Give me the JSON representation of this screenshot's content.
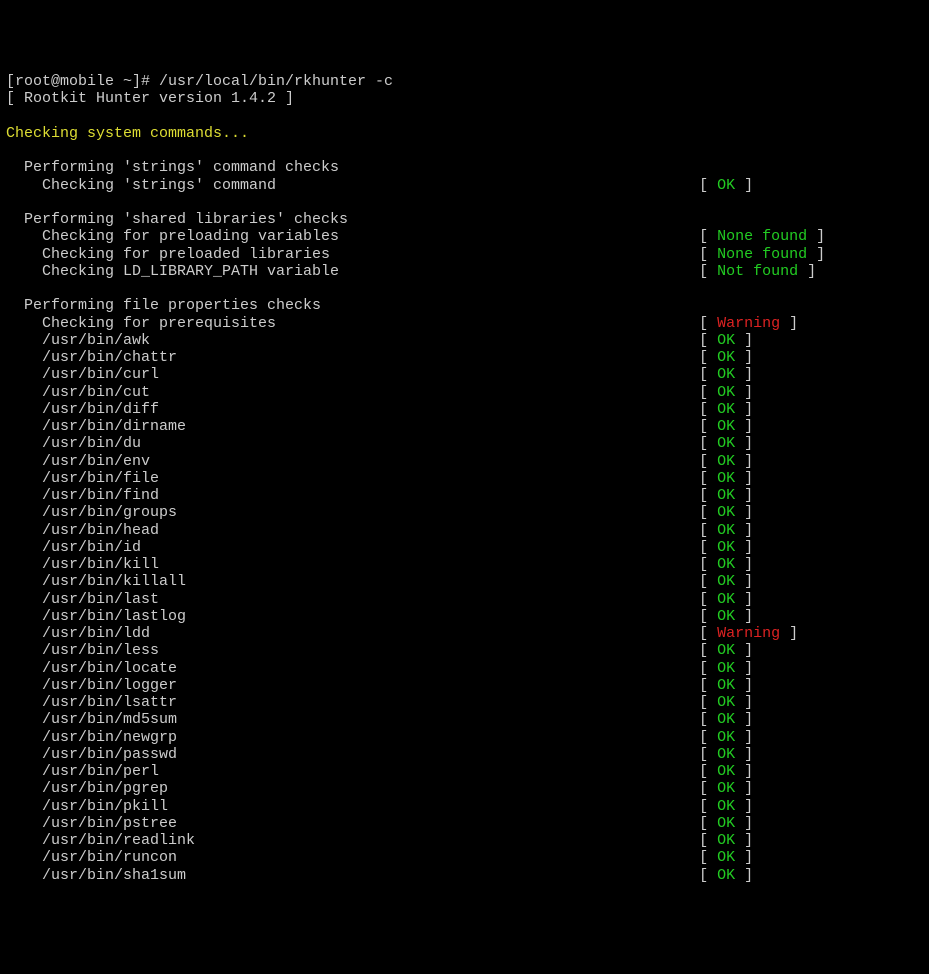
{
  "prompt": "[root@mobile ~]# /usr/local/bin/rkhunter -c",
  "version_line": "[ Rootkit Hunter version 1.4.2 ]",
  "heading": "Checking system commands...",
  "groups": [
    {
      "title": "Performing 'strings' command checks",
      "items": [
        {
          "label": "Checking 'strings' command",
          "status": "OK",
          "cls": "green"
        }
      ]
    },
    {
      "title": "Performing 'shared libraries' checks",
      "items": [
        {
          "label": "Checking for preloading variables",
          "status": "None found",
          "cls": "green"
        },
        {
          "label": "Checking for preloaded libraries",
          "status": "None found",
          "cls": "green"
        },
        {
          "label": "Checking LD_LIBRARY_PATH variable",
          "status": "Not found",
          "cls": "green"
        }
      ]
    },
    {
      "title": "Performing file properties checks",
      "items": [
        {
          "label": "Checking for prerequisites",
          "status": "Warning",
          "cls": "red"
        },
        {
          "label": "/usr/bin/awk",
          "status": "OK",
          "cls": "green"
        },
        {
          "label": "/usr/bin/chattr",
          "status": "OK",
          "cls": "green"
        },
        {
          "label": "/usr/bin/curl",
          "status": "OK",
          "cls": "green"
        },
        {
          "label": "/usr/bin/cut",
          "status": "OK",
          "cls": "green"
        },
        {
          "label": "/usr/bin/diff",
          "status": "OK",
          "cls": "green"
        },
        {
          "label": "/usr/bin/dirname",
          "status": "OK",
          "cls": "green"
        },
        {
          "label": "/usr/bin/du",
          "status": "OK",
          "cls": "green"
        },
        {
          "label": "/usr/bin/env",
          "status": "OK",
          "cls": "green"
        },
        {
          "label": "/usr/bin/file",
          "status": "OK",
          "cls": "green"
        },
        {
          "label": "/usr/bin/find",
          "status": "OK",
          "cls": "green"
        },
        {
          "label": "/usr/bin/groups",
          "status": "OK",
          "cls": "green"
        },
        {
          "label": "/usr/bin/head",
          "status": "OK",
          "cls": "green"
        },
        {
          "label": "/usr/bin/id",
          "status": "OK",
          "cls": "green"
        },
        {
          "label": "/usr/bin/kill",
          "status": "OK",
          "cls": "green"
        },
        {
          "label": "/usr/bin/killall",
          "status": "OK",
          "cls": "green"
        },
        {
          "label": "/usr/bin/last",
          "status": "OK",
          "cls": "green"
        },
        {
          "label": "/usr/bin/lastlog",
          "status": "OK",
          "cls": "green"
        },
        {
          "label": "/usr/bin/ldd",
          "status": "Warning",
          "cls": "red"
        },
        {
          "label": "/usr/bin/less",
          "status": "OK",
          "cls": "green"
        },
        {
          "label": "/usr/bin/locate",
          "status": "OK",
          "cls": "green"
        },
        {
          "label": "/usr/bin/logger",
          "status": "OK",
          "cls": "green"
        },
        {
          "label": "/usr/bin/lsattr",
          "status": "OK",
          "cls": "green"
        },
        {
          "label": "/usr/bin/md5sum",
          "status": "OK",
          "cls": "green"
        },
        {
          "label": "/usr/bin/newgrp",
          "status": "OK",
          "cls": "green"
        },
        {
          "label": "/usr/bin/passwd",
          "status": "OK",
          "cls": "green"
        },
        {
          "label": "/usr/bin/perl",
          "status": "OK",
          "cls": "green"
        },
        {
          "label": "/usr/bin/pgrep",
          "status": "OK",
          "cls": "green"
        },
        {
          "label": "/usr/bin/pkill",
          "status": "OK",
          "cls": "green"
        },
        {
          "label": "/usr/bin/pstree",
          "status": "OK",
          "cls": "green"
        },
        {
          "label": "/usr/bin/readlink",
          "status": "OK",
          "cls": "green"
        },
        {
          "label": "/usr/bin/runcon",
          "status": "OK",
          "cls": "green"
        },
        {
          "label": "/usr/bin/sha1sum",
          "status": "OK",
          "cls": "green"
        }
      ]
    }
  ]
}
